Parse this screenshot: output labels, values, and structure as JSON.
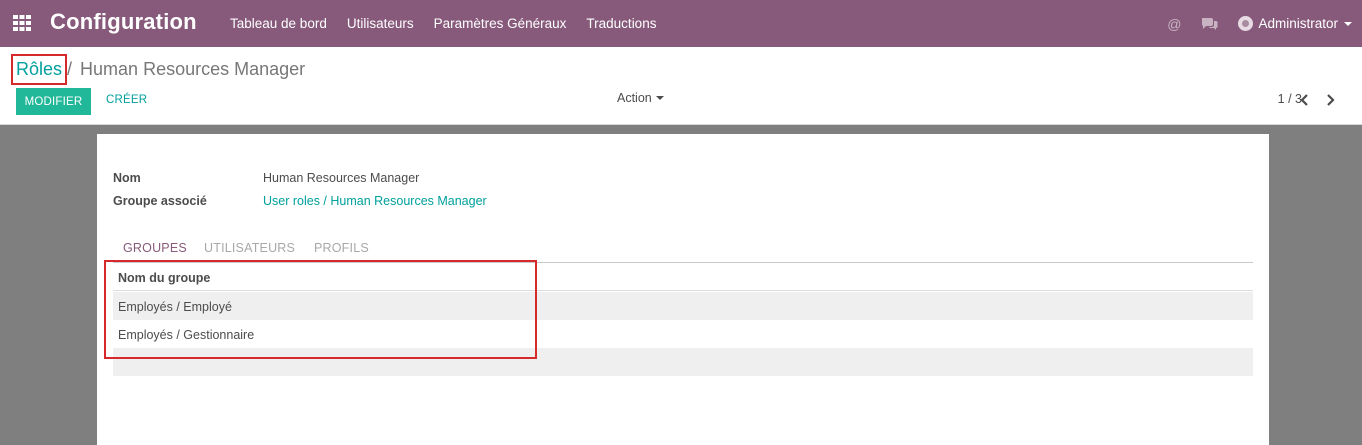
{
  "navbar": {
    "apps_icon": "apps-grid-icon",
    "brand": "Configuration",
    "menu": [
      {
        "label": "Tableau de bord"
      },
      {
        "label": "Utilisateurs"
      },
      {
        "label": "Paramètres Généraux"
      },
      {
        "label": "Traductions"
      }
    ],
    "mention_icon": "at-icon",
    "chat_icon": "chat-icon",
    "user_name": "Administrator",
    "bg_color": "#875a7b"
  },
  "breadcrumb": {
    "parent": "Rôles",
    "separator": "/",
    "current": "Human Resources Manager"
  },
  "toolbar": {
    "edit_label": "MODIFIER",
    "create_label": "CRÉER",
    "action_label": "Action",
    "pager": "1 / 3",
    "prev_icon": "chevron-left-icon",
    "next_icon": "chevron-right-icon",
    "accent_color": "#21b799"
  },
  "form": {
    "name_label": "Nom",
    "name_value": "Human Resources Manager",
    "group_label": "Groupe associé",
    "group_value": "User roles / Human Resources Manager"
  },
  "tabs": [
    {
      "label": "GROUPES",
      "active": true
    },
    {
      "label": "UTILISATEURS",
      "active": false
    },
    {
      "label": "PROFILS",
      "active": false
    }
  ],
  "table": {
    "header": "Nom du groupe",
    "rows": [
      "Employés / Employé",
      "Employés / Gestionnaire",
      ""
    ]
  }
}
